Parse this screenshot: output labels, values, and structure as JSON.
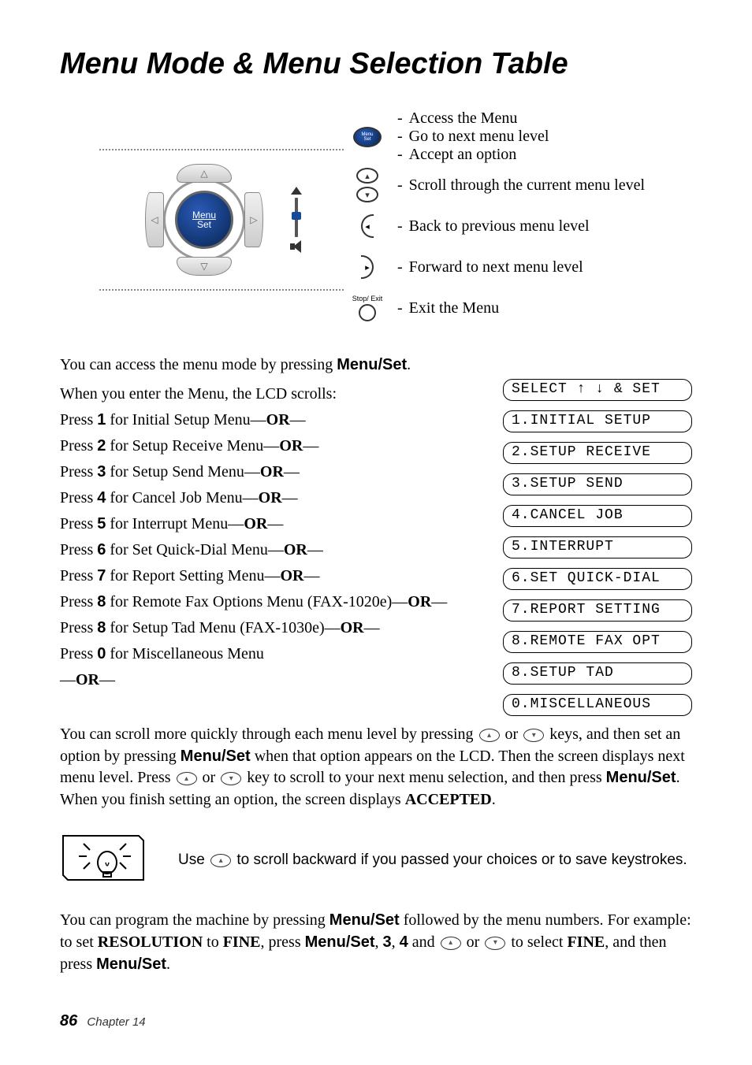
{
  "title": "Menu Mode & Menu Selection Table",
  "diagram": {
    "center_top": "Menu",
    "center_bottom": "Set"
  },
  "legend": {
    "menuset": [
      "Access the Menu",
      "Go to next menu level",
      "Accept an option"
    ],
    "updown": [
      "Scroll through the current menu level"
    ],
    "left": [
      "Back to previous menu level"
    ],
    "right": [
      "Forward to next menu level"
    ],
    "stop_label": "Stop/\nExit",
    "stop": [
      "Exit the Menu"
    ]
  },
  "access_line_pre": "You can access the menu mode by pressing ",
  "access_line_btn": "Menu/Set",
  "access_line_post": ".",
  "scroll_line": "When you enter the Menu, the LCD scrolls:",
  "menu_lines": [
    {
      "pre": "Press ",
      "num": "1",
      "mid": " for Initial Setup Menu—",
      "or": "OR",
      "post": "—"
    },
    {
      "pre": "Press ",
      "num": "2",
      "mid": " for Setup Receive Menu—",
      "or": "OR",
      "post": "—"
    },
    {
      "pre": "Press ",
      "num": "3",
      "mid": " for Setup Send Menu—",
      "or": "OR",
      "post": "—"
    },
    {
      "pre": "Press ",
      "num": "4",
      "mid": " for Cancel Job Menu—",
      "or": "OR",
      "post": "—"
    },
    {
      "pre": "Press ",
      "num": "5",
      "mid": " for Interrupt Menu—",
      "or": "OR",
      "post": "—"
    },
    {
      "pre": "Press ",
      "num": "6",
      "mid": " for Set Quick-Dial Menu—",
      "or": "OR",
      "post": "—"
    },
    {
      "pre": "Press ",
      "num": "7",
      "mid": " for Report Setting Menu—",
      "or": "OR",
      "post": "—"
    },
    {
      "pre": "Press ",
      "num": "8",
      "mid": " for Remote Fax Options Menu (FAX-1020e)—",
      "or": "OR",
      "post": "—"
    },
    {
      "pre": "Press ",
      "num": "8",
      "mid": " for Setup Tad Menu (FAX-1030e)—",
      "or": "OR",
      "post": "—"
    },
    {
      "pre": "Press ",
      "num": "0",
      "mid": " for Miscellaneous Menu",
      "or": "",
      "post": ""
    }
  ],
  "trailing_or": "—OR—",
  "lcd": [
    "SELECT ↑ ↓ & SET",
    "1.INITIAL SETUP",
    "2.SETUP RECEIVE",
    "3.SETUP SEND",
    "4.CANCEL JOB",
    "5.INTERRUPT",
    "6.SET QUICK-DIAL",
    "7.REPORT SETTING",
    "8.REMOTE FAX OPT",
    "8.SETUP TAD",
    "0.MISCELLANEOUS"
  ],
  "para1": {
    "t0": "You can scroll more quickly through each menu level by pressing ",
    "t1": " or ",
    "t2": " keys, and then set an option by pressing ",
    "btn1": "Menu/Set",
    "t3": " when that option appears on the LCD. Then the screen displays next menu level. Press ",
    "t4": " or ",
    "t5": " key to scroll to your next menu selection, and then press ",
    "btn2": "Menu/Set",
    "t6": ". When you finish setting an option, the screen displays ",
    "acc": "ACCEPTED",
    "t7": "."
  },
  "tip": {
    "pre": "Use ",
    "post": " to scroll backward if you passed your choices or to save keystrokes."
  },
  "para2": {
    "t0": "You can program the machine by pressing ",
    "btn1": "Menu/Set",
    "t1": " followed by the menu numbers. For example: to set ",
    "res": "RESOLUTION",
    "t2": " to ",
    "fine1": "FINE",
    "t3": ", press ",
    "btn2": "Menu/Set",
    "t4": ", ",
    "n3": "3",
    "t5": ", ",
    "n4": "4",
    "t6": " and ",
    "t7": " or ",
    "t8": " to select ",
    "fine2": "FINE",
    "t9": ", and then press ",
    "btn3": "Menu/Set",
    "t10": "."
  },
  "footer": {
    "page": "86",
    "chapter": "Chapter 14"
  }
}
